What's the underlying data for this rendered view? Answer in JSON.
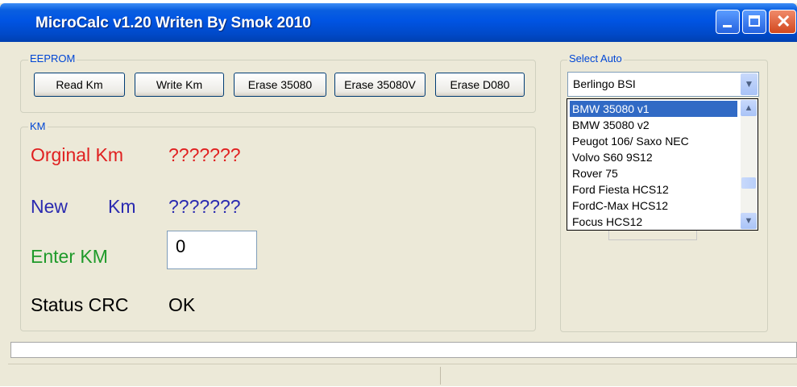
{
  "window": {
    "title": "MicroCalc v1.20 Writen By Smok 2010"
  },
  "eeprom": {
    "group_label": "EEPROM",
    "buttons": {
      "read_km": "Read Km",
      "write_km": "Write  Km",
      "erase_35080": "Erase 35080",
      "erase_35080v": "Erase 35080V",
      "erase_d080": "Erase D080"
    }
  },
  "km": {
    "group_label": "KM",
    "original_label": "Orginal Km",
    "original_value": "???????",
    "new_label_part1": "New",
    "new_label_part2": "Km",
    "new_value": "???????",
    "enter_label": "Enter KM",
    "enter_value": "0",
    "status_label": "Status CRC",
    "status_value": "OK"
  },
  "select_auto": {
    "group_label": "Select Auto",
    "selected": "Berlingo BSI",
    "options": [
      "BMW 35080 v1",
      "BMW 35080 v2",
      "Peugot 106/ Saxo NEC",
      "Volvo S60 9S12",
      "Rover 75",
      "Ford Fiesta HCS12",
      "FordC-Max HCS12",
      "Focus HCS12"
    ],
    "highlighted_option": "BMW 35080 v1"
  },
  "icons": {
    "minimize": "minimize-icon",
    "maximize": "maximize-icon",
    "close": "close-icon",
    "dropdown_arrow": "chevron-down-icon",
    "scroll_up": "chevron-up-icon",
    "scroll_down": "chevron-down-icon"
  },
  "colors": {
    "titlebar": "#0054e3",
    "original_km": "#e02020",
    "new_km": "#2a2ab0",
    "enter_km": "#1f9a2a",
    "selection": "#316ac5"
  }
}
